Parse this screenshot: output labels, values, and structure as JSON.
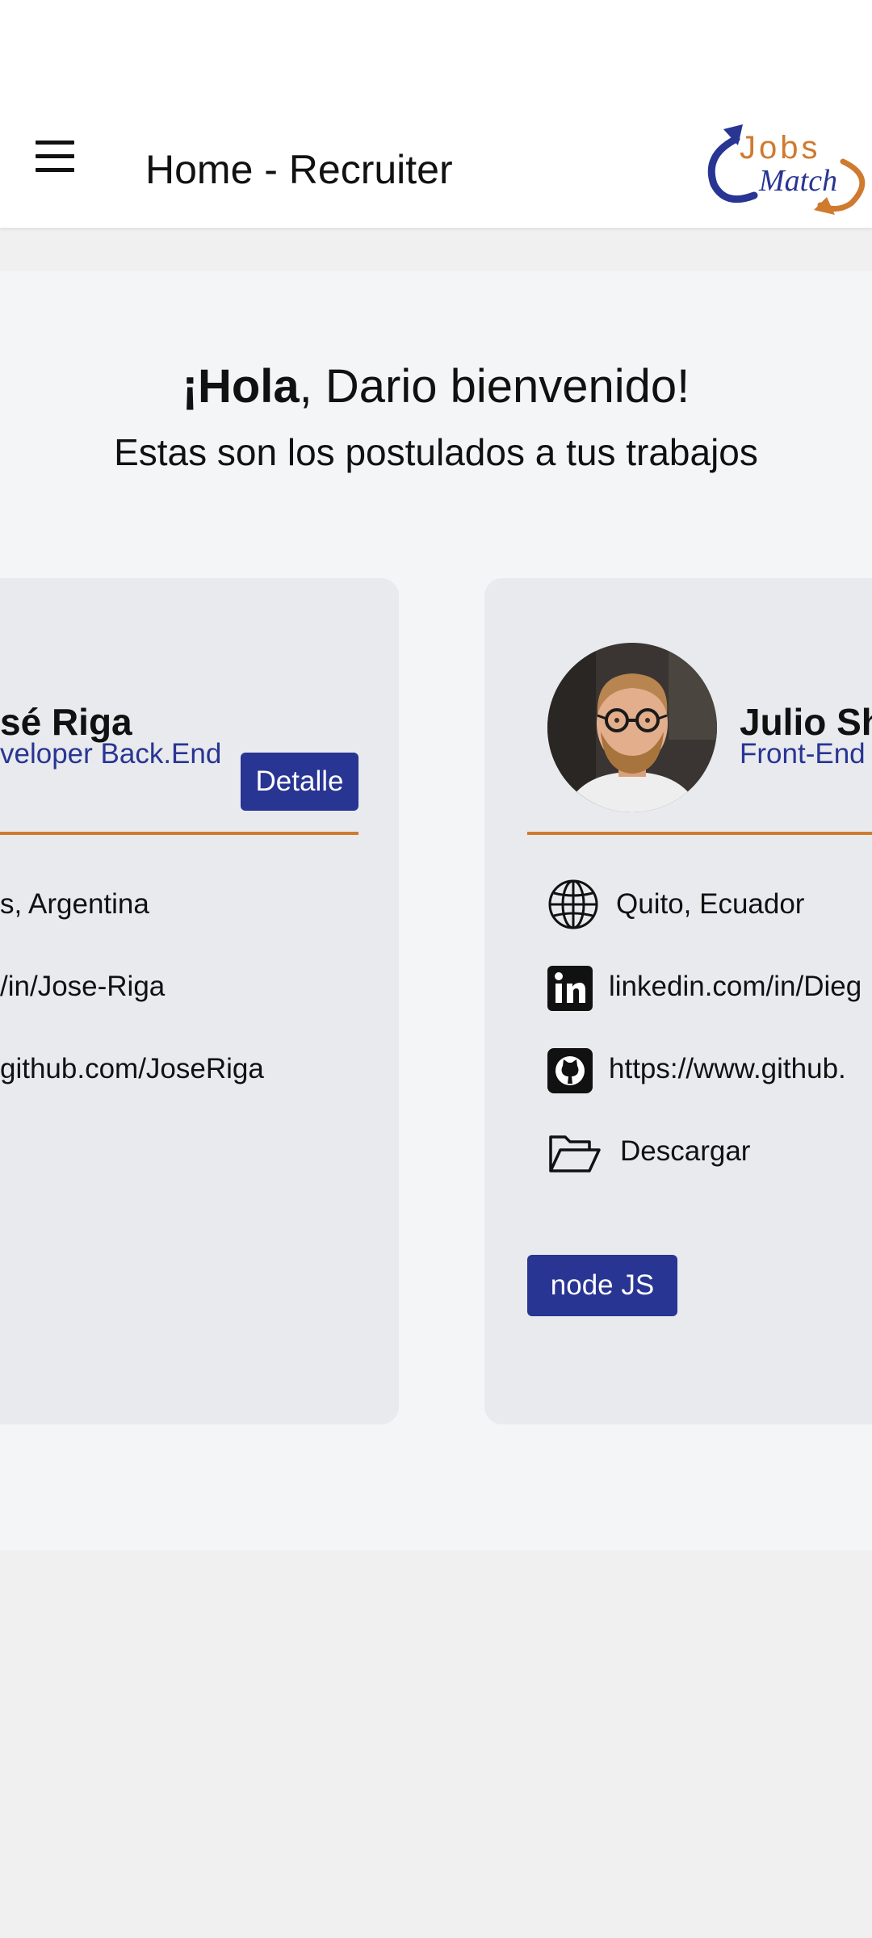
{
  "appbar": {
    "title": "Home - Recruiter",
    "logo_text_top": "Jobs",
    "logo_text_bottom": "Match"
  },
  "welcome": {
    "hola": "¡Hola",
    "rest": ", Dario bienvenido!",
    "subtitle": "Estas son los postulados a tus trabajos"
  },
  "candidates": [
    {
      "name": "sé Riga",
      "role": "veloper Back.End",
      "detail_label": "Detalle",
      "location": "s, Argentina",
      "linkedin": "/in/Jose-Riga",
      "github": "github.com/JoseRiga"
    },
    {
      "name": "Julio Sh",
      "role": "Front-End",
      "location": "Quito, Ecuador",
      "linkedin": "linkedin.com/in/Dieg",
      "github": "https://www.github.",
      "cv_label": "Descargar",
      "skill": "node JS"
    }
  ],
  "colors": {
    "primary": "#283593",
    "accent": "#d07a30",
    "card_bg": "#e9eaee",
    "content_bg": "#f4f5f7"
  }
}
